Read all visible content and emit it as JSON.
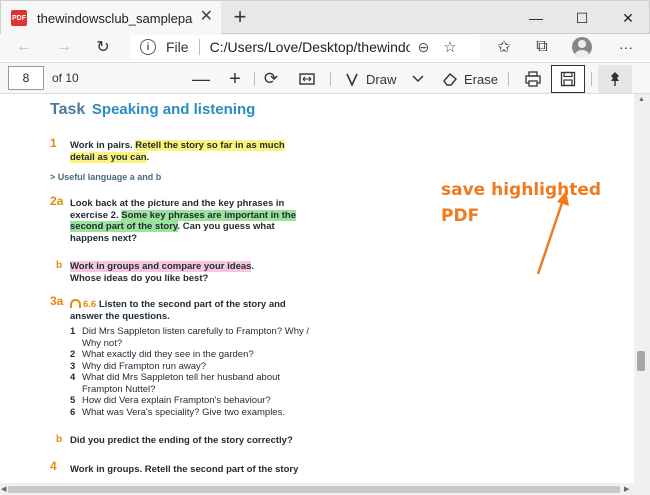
{
  "browser": {
    "tab_badge": "PDF",
    "tab_title": "thewindowsclub_samplepages.pdf",
    "url_scheme_label": "File",
    "url": "C:/Users/Love/Desktop/thewindowsclub_samplepages.pdf"
  },
  "pdf_toolbar": {
    "page_number": "8",
    "page_total": "of 10",
    "draw_label": "Draw",
    "erase_label": "Erase"
  },
  "document": {
    "task_word": "Task",
    "task_title": "Speaking and listening",
    "q1_number": "1",
    "q1_plain": "Work in pairs. ",
    "q1_highlight": "Retell the story so far in as much detail as you can",
    "q1_end": ".",
    "useful_language": "> Useful language a and b",
    "q2a_number": "2a",
    "q2a_plain": "Look back at the picture and the key phrases in exercise 2. ",
    "q2a_highlight": "Some key phrases are important in the second part of the story",
    "q2a_end": ". Can you guess what happens next?",
    "q2b_number": "b",
    "q2b_highlight": "Work in groups and compare your ideas",
    "q2b_end": ".",
    "q2b_line2": "Whose ideas do you like best?",
    "q3a_number": "3a",
    "q3a_audio": "6.6",
    "q3a_text": " Listen to the second part of the story and answer the questions.",
    "questions": [
      {
        "n": "1",
        "text": "Did Mrs Sappleton listen carefully to Frampton? Why / Why not?"
      },
      {
        "n": "2",
        "text": "What exactly did they see in the garden?"
      },
      {
        "n": "3",
        "text": "Why did Frampton run away?"
      },
      {
        "n": "4",
        "text": "What did Mrs Sappleton tell her husband about Frampton Nuttel?"
      },
      {
        "n": "5",
        "text": "How did Vera explain Frampton's behaviour?"
      },
      {
        "n": "6",
        "text": "What was Vera's speciality? Give two examples."
      }
    ],
    "q3b_number": "b",
    "q3b_text": "Did you predict the ending of the story correctly?",
    "q4_number": "4",
    "q4_text": "Work in groups. Retell the second part of the story"
  },
  "annotation": {
    "line1": "save highlighted",
    "line2": "PDF",
    "color": "#f07a1e"
  },
  "icons": [
    "back-icon",
    "forward-icon",
    "refresh-icon",
    "info-icon",
    "zoom-icon",
    "favorite-icon",
    "favorites-list-icon",
    "collections-icon",
    "avatar",
    "more-icon",
    "zoom-out-icon",
    "zoom-in-icon",
    "rotate-icon",
    "fit-page-icon",
    "draw-icon",
    "erase-icon",
    "print-icon",
    "save-icon",
    "pin-icon"
  ]
}
